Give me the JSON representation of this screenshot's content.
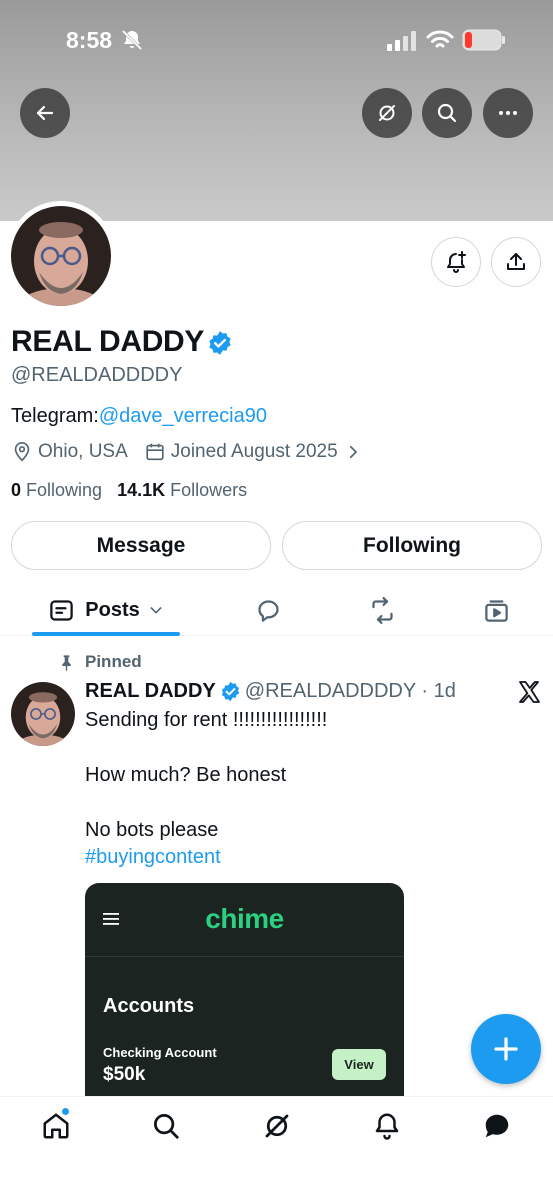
{
  "status_bar": {
    "time": "8:58"
  },
  "profile": {
    "display_name": "REAL DADDY",
    "handle": "@REALDADDDDY",
    "bio_prefix": "Telegram:",
    "bio_link": "@dave_verrecia90",
    "location": "Ohio, USA",
    "joined": "Joined August 2025",
    "following_count": "0",
    "following_label": "Following",
    "followers_count": "14.1K",
    "followers_label": "Followers"
  },
  "buttons": {
    "message": "Message",
    "following": "Following"
  },
  "tabs": {
    "posts": "Posts"
  },
  "post": {
    "pinned_label": "Pinned",
    "author_name": "REAL DADDY",
    "author_handle": "@REALDADDDDY · 1d",
    "line1": "Sending for rent !!!!!!!!!!!!!!!!!",
    "line2": "How much? Be honest",
    "line3": "No bots please",
    "hashtag": "#buyingcontent"
  },
  "chime_card": {
    "logo": "chime",
    "accounts": "Accounts",
    "checking": "Checking Account",
    "balance": "$50k",
    "view": "View"
  },
  "colors": {
    "accent": "#1d9bf0",
    "chime_green": "#2bd17e",
    "card_bg": "#1b2420"
  }
}
